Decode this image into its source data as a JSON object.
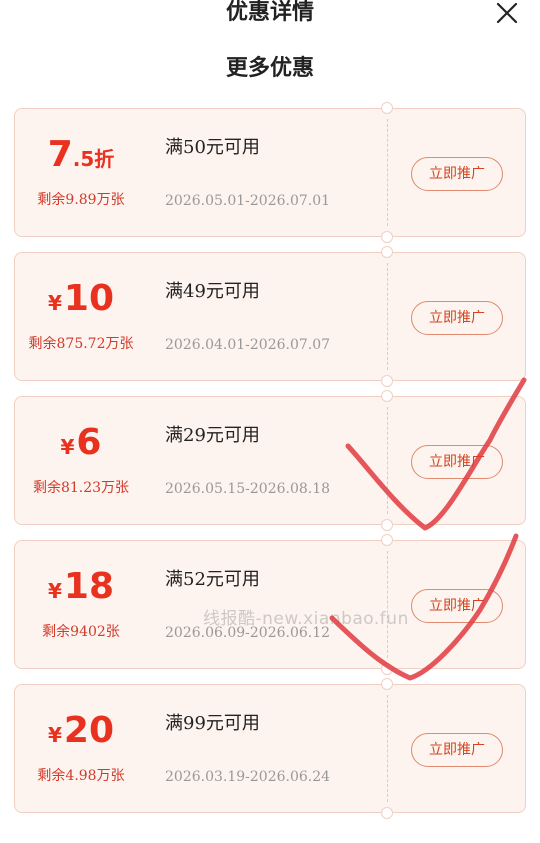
{
  "header": {
    "title": "优惠详情",
    "close_icon": "close-icon"
  },
  "section": {
    "title": "更多优惠"
  },
  "colors": {
    "accent": "#e8311f",
    "card_bg": "#fdf3ef",
    "card_border": "#f2cfc3",
    "check_mark": "#e0393f"
  },
  "coupons": [
    {
      "amount_main": "7",
      "amount_sub": ".5折",
      "currency": "",
      "remaining": "剩余9.89万张",
      "condition": "满50元可用",
      "dates": "2026.05.01-2026.07.01",
      "button": "立即推广"
    },
    {
      "amount_main": "10",
      "amount_sub": "",
      "currency": "¥",
      "remaining": "剩余875.72万张",
      "condition": "满49元可用",
      "dates": "2026.04.01-2026.07.07",
      "button": "立即推广"
    },
    {
      "amount_main": "6",
      "amount_sub": "",
      "currency": "¥",
      "remaining": "剩余81.23万张",
      "condition": "满29元可用",
      "dates": "2026.05.15-2026.08.18",
      "button": "立即推广"
    },
    {
      "amount_main": "18",
      "amount_sub": "",
      "currency": "¥",
      "remaining": "剩余9402张",
      "condition": "满52元可用",
      "dates": "2026.06.09-2026.06.12",
      "button": "立即推广"
    },
    {
      "amount_main": "20",
      "amount_sub": "",
      "currency": "¥",
      "remaining": "剩余4.98万张",
      "condition": "满99元可用",
      "dates": "2026.03.19-2026.06.24",
      "button": "立即推广"
    }
  ],
  "watermark": "线报酷-new.xianbao.fun"
}
